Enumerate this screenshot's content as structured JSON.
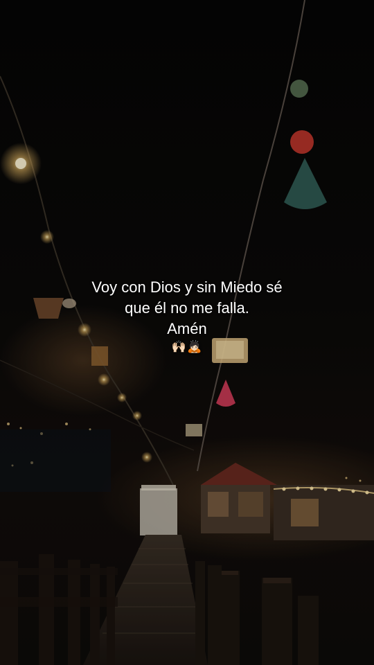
{
  "caption": {
    "line1": "Voy con Dios y sin Miedo sé",
    "line2": "que él no me falla.",
    "line3": "Amén",
    "emoji": "🙌🏻🙇🏻"
  },
  "colors": {
    "text": "#ffffff",
    "background": "#050505",
    "lights": "#f6d48a",
    "pompom_red": "#c0392b",
    "pompom_teal": "#2f5a52"
  }
}
